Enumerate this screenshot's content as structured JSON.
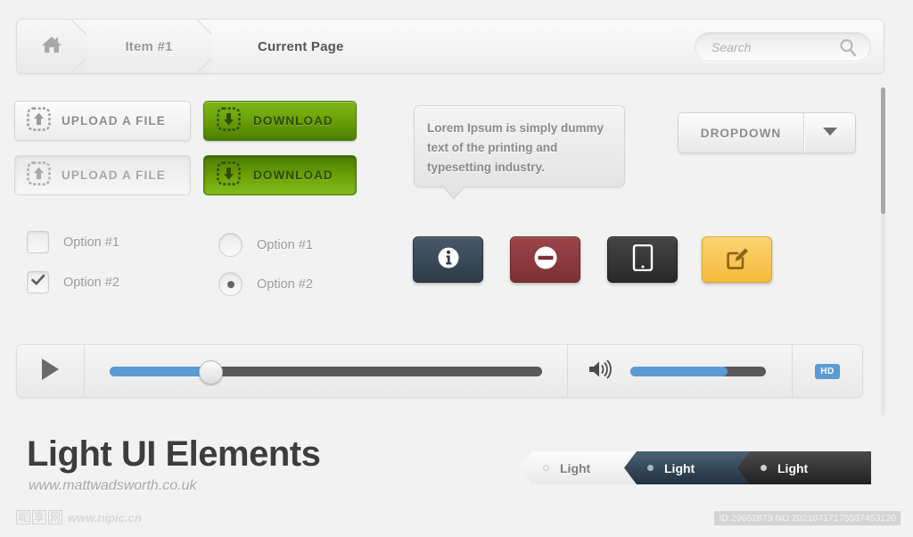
{
  "breadcrumb": {
    "home_icon": "home-icon",
    "items": [
      {
        "label": "Item #1"
      },
      {
        "label": "Current Page"
      }
    ]
  },
  "search": {
    "placeholder": "Search",
    "value": "",
    "icon": "search-icon"
  },
  "buttons": {
    "upload_1": {
      "label": "UPLOAD A FILE",
      "icon": "upload-arrow-icon"
    },
    "upload_2": {
      "label": "UPLOAD A FILE",
      "icon": "upload-arrow-icon"
    },
    "download_1": {
      "label": "DOWNLOAD",
      "icon": "download-arrow-icon"
    },
    "download_2": {
      "label": "DOWNLOAD",
      "icon": "download-arrow-icon"
    }
  },
  "tooltip": {
    "text": "Lorem Ipsum is simply dummy text of the printing and typesetting industry."
  },
  "dropdown": {
    "label": "DROPDOWN",
    "caret_icon": "chevron-down-icon"
  },
  "checkboxes": [
    {
      "label": "Option #1",
      "checked": false
    },
    {
      "label": "Option #2",
      "checked": true
    }
  ],
  "radios": [
    {
      "label": "Option #1",
      "selected": false
    },
    {
      "label": "Option #2",
      "selected": true
    }
  ],
  "icon_buttons": [
    {
      "name": "info-button",
      "icon": "info-circle-icon",
      "color": "#3b4a57"
    },
    {
      "name": "block-button",
      "icon": "no-entry-icon",
      "color": "#8e3b3f"
    },
    {
      "name": "tablet-button",
      "icon": "tablet-device-icon",
      "color": "#3a3a3a"
    },
    {
      "name": "edit-button",
      "icon": "edit-square-icon",
      "color": "#f9c552"
    }
  ],
  "player": {
    "play_icon": "play-icon",
    "seek_percent": 23,
    "volume_icon": "volume-high-icon",
    "volume_percent": 72,
    "hd_label": "HD",
    "accent_color": "#5b9bd5"
  },
  "footer": {
    "title": "Light UI Elements",
    "url": "www.mattwadsworth.co.uk"
  },
  "tags": [
    {
      "label": "Light",
      "style": "light"
    },
    {
      "label": "Light",
      "style": "blue"
    },
    {
      "label": "Light",
      "style": "dark"
    }
  ],
  "watermark": {
    "cn_chars": [
      "昵",
      "享",
      "网"
    ],
    "url": "www.nipic.cn",
    "id_text": "ID:29652873 NO:20210717175537453120"
  }
}
